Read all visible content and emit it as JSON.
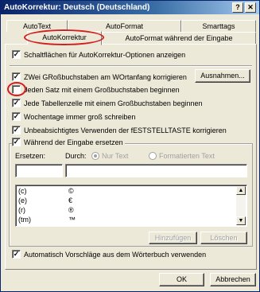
{
  "window": {
    "title": "AutoKorrektur: Deutsch (Deutschland)",
    "help_button": "?",
    "close_button": "✕"
  },
  "tabs": {
    "row1": [
      "AutoText",
      "AutoFormat",
      "Smarttags"
    ],
    "row2": [
      "AutoKorrektur",
      "AutoFormat während der Eingabe"
    ]
  },
  "options": {
    "show_buttons": "Schaltflächen für AutoKorrektur-Optionen anzeigen",
    "two_caps": "ZWei GRoßbuchstaben am WOrtanfang korrigieren",
    "exceptions_button": "Ausnahmen...",
    "sentence_start": "Jeden Satz mit einem Großbuchstaben beginnen",
    "table_cells": "Jede Tabellenzelle mit einem Großbuchstaben beginnen",
    "weekdays": "Wochentage immer groß schreiben",
    "capslock": "Unbeabsichtigtes Verwenden der fESTSTELLTASTE korrigieren",
    "while_typing": "Während der Eingabe ersetzen"
  },
  "replace": {
    "replace_label": "Ersetzen:",
    "with_label": "Durch:",
    "plain_text": "Nur Text",
    "formatted_text": "Formatierten Text",
    "replace_value": "",
    "with_value": ""
  },
  "list": {
    "rows": [
      {
        "from": "(c)",
        "to": "©"
      },
      {
        "from": "(e)",
        "to": "€"
      },
      {
        "from": "(r)",
        "to": "®"
      },
      {
        "from": "(tm)",
        "to": "™"
      }
    ]
  },
  "buttons": {
    "add": "Hinzufügen",
    "delete": "Löschen",
    "ok": "OK",
    "cancel": "Abbrechen"
  },
  "auto_suggest": "Automatisch Vorschläge aus dem Wörterbuch verwenden",
  "checked": {
    "show_buttons": true,
    "two_caps": true,
    "sentence_start": false,
    "table_cells": true,
    "weekdays": true,
    "capslock": true,
    "while_typing": true,
    "auto_suggest": true
  },
  "colors": {
    "highlight": "#d21f1f",
    "title_bar": "#0a246a",
    "dialog_bg": "#ece9d8"
  }
}
